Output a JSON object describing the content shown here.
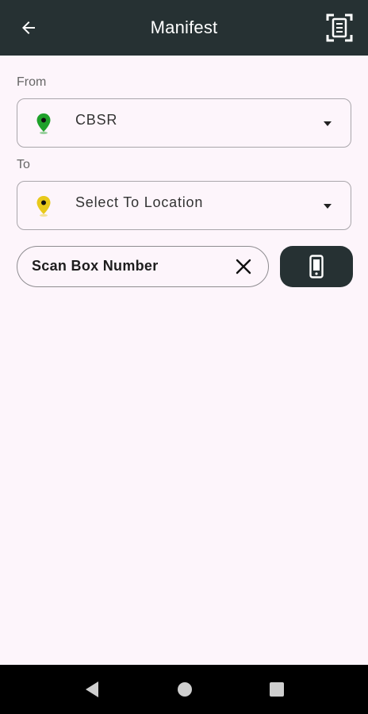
{
  "appbar": {
    "title": "Manifest",
    "back_icon": "arrow-left-icon",
    "scan_icon": "document-scanner-icon",
    "background": "#263133"
  },
  "form": {
    "from_label": "From",
    "from_value": "CBSR",
    "from_pin_color": "#1fa12a",
    "to_label": "To",
    "to_placeholder": "Select To Location",
    "to_pin_color": "#e8c91b"
  },
  "scan": {
    "value": "Scan Box Number",
    "clear_icon": "close-icon",
    "device_icon": "mobile-device-icon"
  },
  "system_nav": {
    "back": "triangle-back-icon",
    "home": "circle-home-icon",
    "recents": "square-recents-icon"
  }
}
